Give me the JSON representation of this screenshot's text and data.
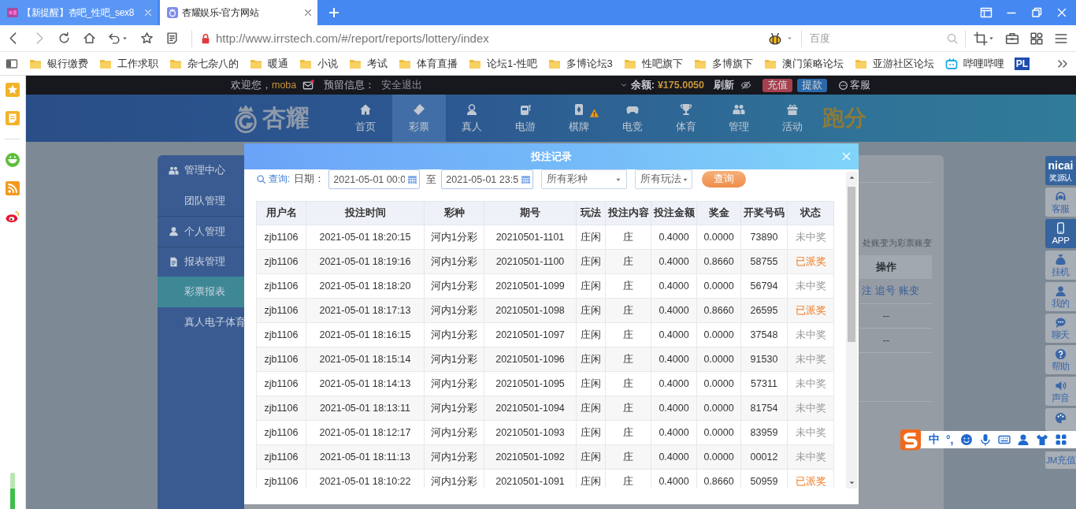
{
  "browser": {
    "tabs": [
      {
        "title": "【新提醒】杏吧_性吧_sex8",
        "selected": false
      },
      {
        "title": "杏耀娱乐-官方网站",
        "selected": true
      }
    ],
    "url": "http://www.irrstech.com/#/report/reports/lottery/index",
    "search_placeholder": "百度",
    "bookmarks": [
      {
        "label": "银行缴费",
        "kind": "folder"
      },
      {
        "label": "工作求职",
        "kind": "folder"
      },
      {
        "label": "杂七杂八的",
        "kind": "folder"
      },
      {
        "label": "暖通",
        "kind": "folder"
      },
      {
        "label": "小说",
        "kind": "folder"
      },
      {
        "label": "考试",
        "kind": "folder"
      },
      {
        "label": "体育直播",
        "kind": "folder"
      },
      {
        "label": "论坛1-性吧",
        "kind": "folder"
      },
      {
        "label": "多博论坛3",
        "kind": "folder"
      },
      {
        "label": "性吧旗下",
        "kind": "folder"
      },
      {
        "label": "多博旗下",
        "kind": "folder"
      },
      {
        "label": "澳门策略论坛",
        "kind": "folder"
      },
      {
        "label": "亚游社区论坛",
        "kind": "folder"
      },
      {
        "label": "哔哩哔哩",
        "kind": "tv"
      },
      {
        "label": "PL",
        "kind": "badge"
      }
    ]
  },
  "topbar": {
    "welcome": "欢迎您，",
    "username": "moba",
    "reserved_info": "预留信息：",
    "logout": "安全退出",
    "balance_label": "余额:",
    "balance": "¥175.0050",
    "refresh": "刷新",
    "deposit": "充值",
    "withdraw": "提款",
    "service": "客服"
  },
  "header": {
    "logo_text": "杏耀",
    "promo": "跑分",
    "nav": [
      {
        "label": "首页",
        "kind": "home",
        "selected": false,
        "alert": false
      },
      {
        "label": "彩票",
        "kind": "lottery",
        "selected": true,
        "alert": false
      },
      {
        "label": "真人",
        "kind": "live",
        "selected": false,
        "alert": false
      },
      {
        "label": "电游",
        "kind": "slots",
        "selected": false,
        "alert": false
      },
      {
        "label": "棋牌",
        "kind": "cards",
        "selected": false,
        "alert": true
      },
      {
        "label": "电竞",
        "kind": "esports",
        "selected": false,
        "alert": false
      },
      {
        "label": "体育",
        "kind": "sports",
        "selected": false,
        "alert": false
      },
      {
        "label": "管理",
        "kind": "manage",
        "selected": false,
        "alert": false
      },
      {
        "label": "活动",
        "kind": "events",
        "selected": false,
        "alert": false
      }
    ]
  },
  "side_menu": [
    {
      "label": "管理中心",
      "kind": "team_section",
      "selected": false
    },
    {
      "label": "团队管理",
      "kind": "link",
      "selected": false
    },
    {
      "label": "个人管理",
      "kind": "personal_section",
      "selected": false
    },
    {
      "label": "报表管理",
      "kind": "report_section",
      "selected": false
    },
    {
      "label": "彩票报表",
      "kind": "link",
      "selected": true
    },
    {
      "label": "真人电子体育",
      "kind": "link",
      "selected": false
    }
  ],
  "report_page": {
    "note": "处账变为彩票账变",
    "action_header": "操作",
    "rows": [
      {
        "links": [
          "注",
          "追号",
          "账变"
        ]
      },
      {
        "text": "--"
      },
      {
        "text": "--"
      }
    ]
  },
  "modal": {
    "title": "投注记录",
    "query": {
      "search_label": "查询:",
      "date_label": "日期：",
      "date_from": "2021-05-01 00:0",
      "to": "至",
      "date_to": "2021-05-01 23:5",
      "lottery_select": "所有彩种",
      "play_select": "所有玩法",
      "button": "查询"
    },
    "table": {
      "columns": [
        "用户名",
        "投注时间",
        "彩种",
        "期号",
        "玩法",
        "投注内容",
        "投注金额",
        "奖金",
        "开奖号码",
        "状态"
      ],
      "rows": [
        {
          "cells": [
            "zjb1106",
            "2021-05-01 18:20:15",
            "河内1分彩",
            "20210501-1101",
            "庄闲",
            "庄",
            "0.4000",
            "0.0000",
            "73890",
            "未中奖"
          ],
          "won": false
        },
        {
          "cells": [
            "zjb1106",
            "2021-05-01 18:19:16",
            "河内1分彩",
            "20210501-1100",
            "庄闲",
            "庄",
            "0.4000",
            "0.8660",
            "58755",
            "已派奖"
          ],
          "won": true
        },
        {
          "cells": [
            "zjb1106",
            "2021-05-01 18:18:20",
            "河内1分彩",
            "20210501-1099",
            "庄闲",
            "庄",
            "0.4000",
            "0.0000",
            "56794",
            "未中奖"
          ],
          "won": false
        },
        {
          "cells": [
            "zjb1106",
            "2021-05-01 18:17:13",
            "河内1分彩",
            "20210501-1098",
            "庄闲",
            "庄",
            "0.4000",
            "0.8660",
            "26595",
            "已派奖"
          ],
          "won": true
        },
        {
          "cells": [
            "zjb1106",
            "2021-05-01 18:16:15",
            "河内1分彩",
            "20210501-1097",
            "庄闲",
            "庄",
            "0.4000",
            "0.0000",
            "37548",
            "未中奖"
          ],
          "won": false
        },
        {
          "cells": [
            "zjb1106",
            "2021-05-01 18:15:14",
            "河内1分彩",
            "20210501-1096",
            "庄闲",
            "庄",
            "0.4000",
            "0.0000",
            "91530",
            "未中奖"
          ],
          "won": false
        },
        {
          "cells": [
            "zjb1106",
            "2021-05-01 18:14:13",
            "河内1分彩",
            "20210501-1095",
            "庄闲",
            "庄",
            "0.4000",
            "0.0000",
            "57311",
            "未中奖"
          ],
          "won": false
        },
        {
          "cells": [
            "zjb1106",
            "2021-05-01 18:13:11",
            "河内1分彩",
            "20210501-1094",
            "庄闲",
            "庄",
            "0.4000",
            "0.0000",
            "81754",
            "未中奖"
          ],
          "won": false
        },
        {
          "cells": [
            "zjb1106",
            "2021-05-01 18:12:17",
            "河内1分彩",
            "20210501-1093",
            "庄闲",
            "庄",
            "0.4000",
            "0.0000",
            "83959",
            "未中奖"
          ],
          "won": false
        },
        {
          "cells": [
            "zjb1106",
            "2021-05-01 18:11:13",
            "河内1分彩",
            "20210501-1092",
            "庄闲",
            "庄",
            "0.4000",
            "0.0000",
            "00012",
            "未中奖"
          ],
          "won": false
        },
        {
          "cells": [
            "zjb1106",
            "2021-05-01 18:10:22",
            "河内1分彩",
            "20210501-1091",
            "庄闲",
            "庄",
            "0.4000",
            "0.8660",
            "50959",
            "已派奖"
          ],
          "won": true
        }
      ]
    }
  },
  "float_bar": [
    {
      "kind": "verify",
      "logo": "nicai",
      "label": "奖源认",
      "highlighted": true
    },
    {
      "kind": "service",
      "label": "客服",
      "highlighted": false
    },
    {
      "kind": "app",
      "label": "APP",
      "highlighted": true
    },
    {
      "kind": "idle",
      "label": "挂机",
      "highlighted": false
    },
    {
      "kind": "mine",
      "label": "我的",
      "highlighted": false
    },
    {
      "kind": "chat",
      "label": "聊天",
      "highlighted": false
    },
    {
      "kind": "help",
      "label": "帮助",
      "highlighted": false
    },
    {
      "kind": "sound",
      "label": "声音",
      "highlighted": false
    },
    {
      "kind": "theme",
      "highlighted": false
    },
    {
      "kind": "recharge",
      "label": "JM充值",
      "highlighted": false
    }
  ],
  "ime_bar": {
    "mode": "中",
    "punctuation": "°,"
  }
}
